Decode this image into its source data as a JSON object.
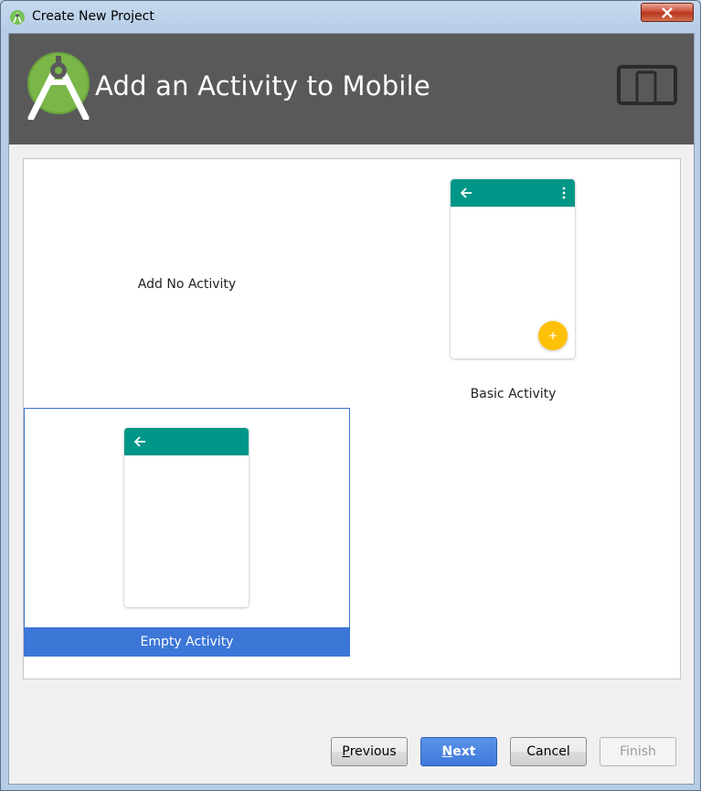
{
  "window": {
    "title": "Create New Project",
    "close_icon": "close-icon"
  },
  "banner": {
    "title": "Add an Activity to Mobile",
    "logo_icon": "android-studio-logo",
    "device_icon": "tablet-phone-icon"
  },
  "gallery": {
    "tiles": [
      {
        "label": "Add No Activity",
        "preview": "none"
      },
      {
        "label": "Basic Activity",
        "preview": "appbar-with-menu-and-fab"
      },
      {
        "label": "Empty Activity",
        "preview": "appbar",
        "selected": true
      }
    ],
    "colors": {
      "appbar": "#009688",
      "fab": "#FFC107",
      "selection": "#3C76D7"
    }
  },
  "buttons": {
    "previous": {
      "mnemonic": "P",
      "rest": "revious"
    },
    "next": {
      "mnemonic": "N",
      "rest": "ext"
    },
    "cancel": "Cancel",
    "finish": "Finish"
  }
}
